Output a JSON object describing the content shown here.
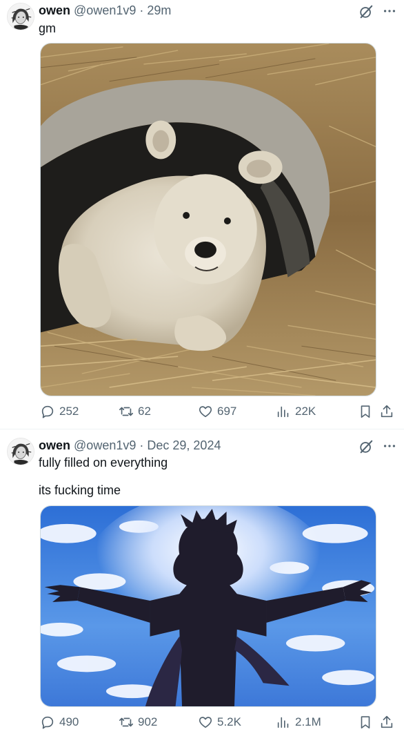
{
  "tweets": [
    {
      "author_name": "owen",
      "author_handle": "@owen1v9",
      "separator": "·",
      "timestamp": "29m",
      "text_lines": [
        "gm"
      ],
      "media_description_icon": "photo",
      "stats": {
        "replies": "252",
        "reposts": "62",
        "likes": "697",
        "views": "22K"
      }
    },
    {
      "author_name": "owen",
      "author_handle": "@owen1v9",
      "separator": "·",
      "timestamp": "Dec 29, 2024",
      "text_lines": [
        "fully filled on everything",
        "its fucking time"
      ],
      "media_description_icon": "photo",
      "stats": {
        "replies": "490",
        "reposts": "902",
        "likes": "5.2K",
        "views": "2.1M"
      }
    }
  ],
  "icons": {
    "reply": "reply-icon",
    "repost": "repost-icon",
    "like": "like-icon",
    "views": "views-icon",
    "bookmark": "bookmark-icon",
    "share": "share-icon",
    "grok": "grok-icon",
    "more": "more-icon"
  },
  "colors": {
    "text_primary": "#0f1419",
    "text_secondary": "#536471",
    "border": "#eff3f4"
  }
}
